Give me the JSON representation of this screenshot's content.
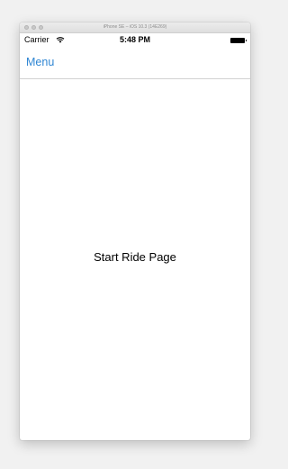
{
  "window": {
    "title": "iPhone SE – iOS 10.3 (14E269)"
  },
  "status_bar": {
    "carrier": "Carrier",
    "wifi_icon": "wifi-icon",
    "time": "5:48 PM",
    "battery_icon": "battery-icon"
  },
  "nav_bar": {
    "menu_label": "Menu",
    "accent_color": "#2f86d3"
  },
  "main": {
    "page_label": "Start Ride Page"
  }
}
